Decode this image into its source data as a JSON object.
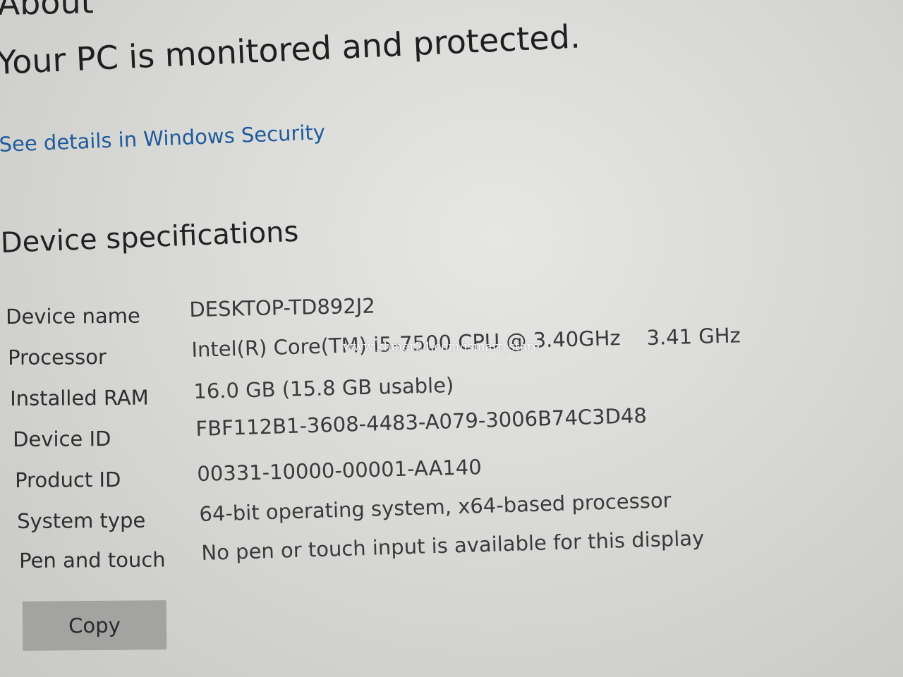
{
  "page": {
    "title": "About",
    "status_headline": "Your PC is monitored and protected.",
    "security_link": "See details in Windows Security"
  },
  "device_specifications": {
    "heading": "Device specifications",
    "rows": [
      {
        "label": "Device name",
        "value": "DESKTOP-TD892J2"
      },
      {
        "label": "Processor",
        "value": "Intel(R) Core(TM) i5-7500 CPU @ 3.40GHz",
        "speed": "3.41 GHz"
      },
      {
        "label": "Installed RAM",
        "value": "16.0 GB (15.8 GB usable)"
      },
      {
        "label": "Device ID",
        "value": "FBF112B1-3608-4483-A079-3006B74C3D48"
      },
      {
        "label": "Product ID",
        "value": "00331-10000-00001-AA140"
      },
      {
        "label": "System type",
        "value": "64-bit operating system, x64-based processor"
      },
      {
        "label": "Pen and touch",
        "value": "No pen or touch input is available for this display"
      }
    ],
    "copy_button_label": "Copy"
  },
  "watermark": "www.khmer24.com/ismart_store",
  "colors": {
    "link": "#1f5a9a",
    "background": "#dcddda",
    "button": "#a3a4a2"
  }
}
